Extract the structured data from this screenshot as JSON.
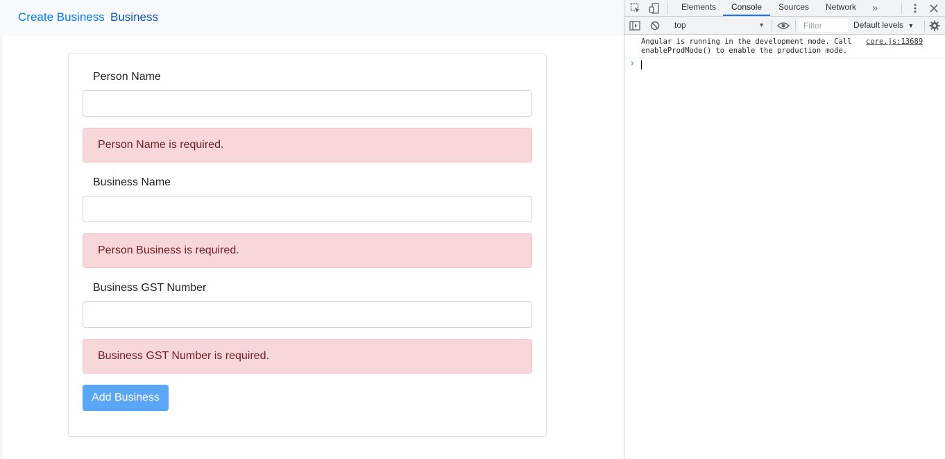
{
  "navbar": {
    "brand_link": "Create Business",
    "business_link": "Business"
  },
  "form": {
    "person_name": {
      "label": "Person Name",
      "value": "",
      "error": "Person Name is required."
    },
    "business_name": {
      "label": "Business Name",
      "value": "",
      "error": "Person Business is required."
    },
    "business_gst": {
      "label": "Business GST Number",
      "value": "",
      "error": "Business GST Number is required."
    },
    "submit_label": "Add Business"
  },
  "devtools": {
    "tabs": [
      "Elements",
      "Console",
      "Sources",
      "Network"
    ],
    "active_tab": "Console",
    "more_tabs_icon": "double-chevron-right-icon",
    "context": "top",
    "filter_placeholder": "Filter",
    "levels_label": "Default levels",
    "console": {
      "line1": "Angular is running in the development mode. Call",
      "line2": "enableProdMode() to enable the production mode.",
      "source": "core.js:13689"
    },
    "accent_color": "#1a73e8"
  },
  "colors": {
    "link": "#007bff",
    "alert_bg": "#f8d7da",
    "alert_text": "#721c24",
    "button_bg": "#5aa6f8"
  }
}
